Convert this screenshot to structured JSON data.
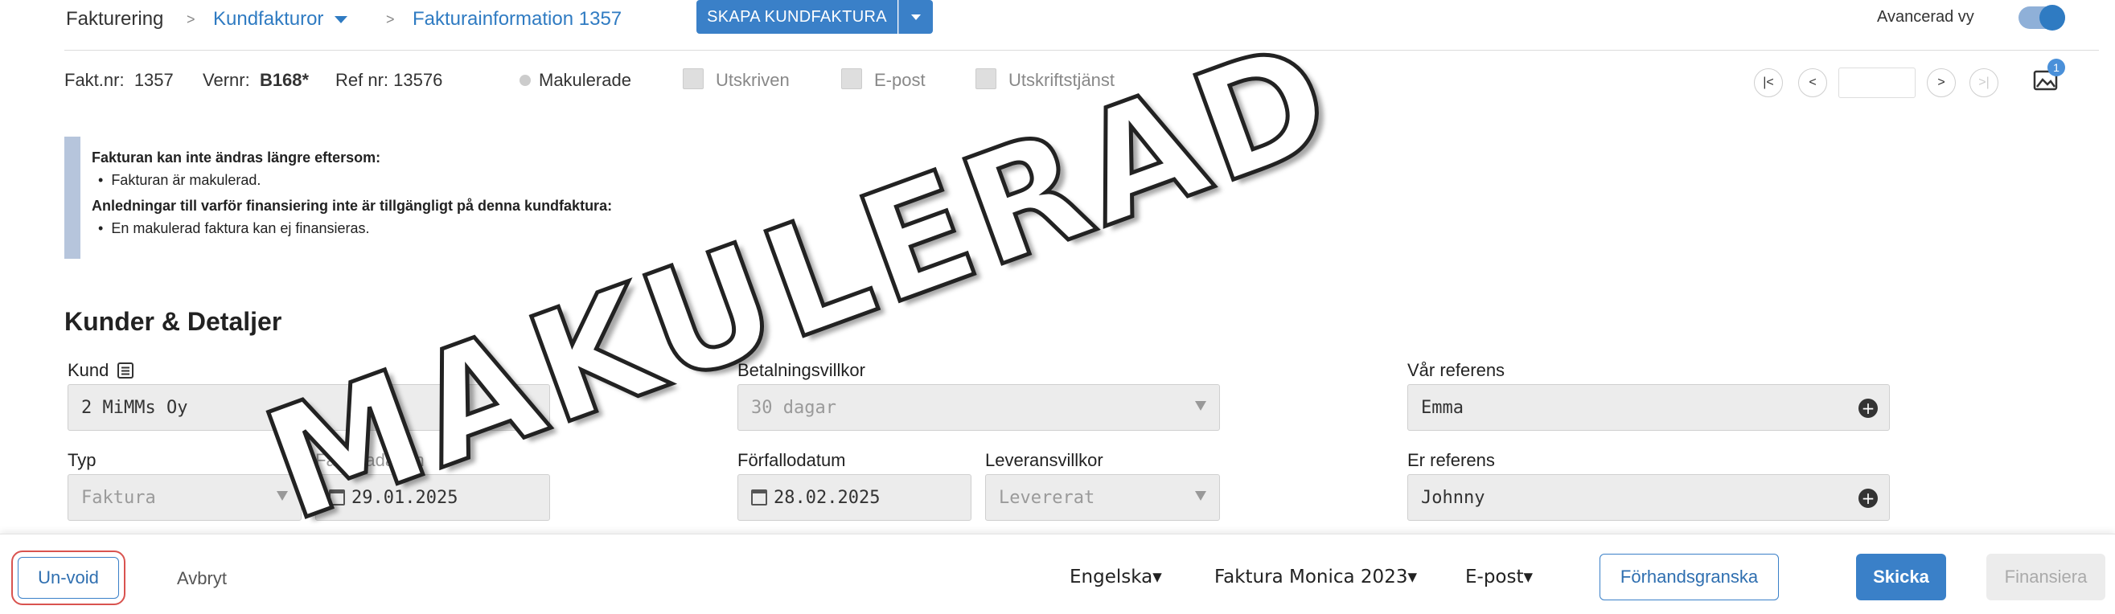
{
  "breadcrumb": {
    "root": "Fakturering",
    "sep1": ">",
    "section": "Kundfakturor",
    "sep2": ">",
    "current": "Fakturainformation 1357"
  },
  "toolbar": {
    "create_label": "SKAPA KUNDFAKTURA",
    "advanced_label": "Avancerad vy",
    "advanced_on": true
  },
  "meta": {
    "invoice_label": "Fakt.nr:",
    "invoice_value": "1357",
    "vernr_label": "Vernr:",
    "vernr_value": "B168*",
    "ref_label": "Ref nr:",
    "ref_value": "13576",
    "voided_label": "Makulerade",
    "printed_label": "Utskriven",
    "email_label": "E-post",
    "print_service_label": "Utskriftstjänst"
  },
  "nav": {
    "first": "|<",
    "prev": "<",
    "next": ">",
    "last": ">|",
    "attachments_count": "1"
  },
  "notice": {
    "title1": "Fakturan kan inte ändras längre eftersom:",
    "item1": "Fakturan är makulerad.",
    "title2": "Anledningar till varför finansiering inte är tillgängligt på denna kundfaktura:",
    "item2": "En makulerad faktura kan ej finansieras."
  },
  "section": {
    "title": "Kunder & Detaljer"
  },
  "form": {
    "customer_label": "Kund",
    "customer_value": "2 MiMMs Oy",
    "payment_terms_label": "Betalningsvillkor",
    "payment_terms_value": "30 dagar",
    "our_ref_label": "Vår referens",
    "our_ref_value": "Emma",
    "type_label": "Typ",
    "type_value": "Faktura",
    "invoice_date_label": "Fakturadatum",
    "invoice_date_value": "29.01.2025",
    "due_date_label": "Förfallodatum",
    "due_date_value": "28.02.2025",
    "delivery_terms_label": "Leveransvillkor",
    "delivery_terms_value": "Levererat",
    "your_ref_label": "Er referens",
    "your_ref_value": "Johnny"
  },
  "watermark": "MAKULERAD",
  "footer": {
    "unvoid_label": "Un-void",
    "cancel_label": "Avbryt",
    "language_value": "Engelska▾",
    "template_value": "Faktura Monica 2023▾",
    "delivery_value": "E-post▾",
    "preview_label": "Förhandsgranska",
    "send_label": "Skicka",
    "finance_label": "Finansiera"
  },
  "colors": {
    "accent": "#3a80c8",
    "unvoid_highlight": "#d9534f"
  }
}
